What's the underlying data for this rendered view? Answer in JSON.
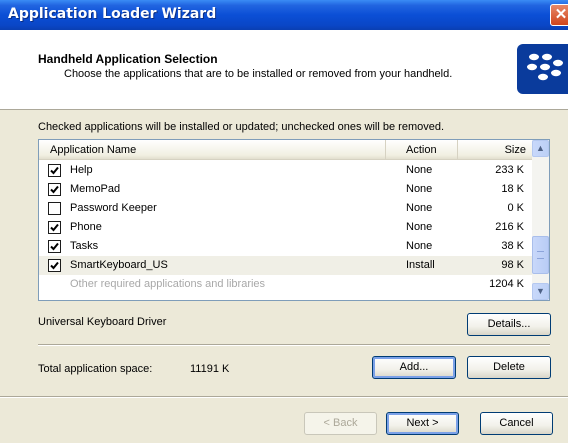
{
  "window": {
    "title": "Application Loader Wizard",
    "close_glyph": "✕"
  },
  "header": {
    "title": "Handheld Application Selection",
    "subtitle": "Choose the applications that are to be installed or removed from your handheld.",
    "logo": "blackberry-logo"
  },
  "info_text": "Checked applications will be installed or updated; unchecked ones will be removed.",
  "list": {
    "columns": [
      "Application Name",
      "Action",
      "Size"
    ],
    "rows": [
      {
        "name": "Help",
        "checked": true,
        "action": "None",
        "size": "233 K"
      },
      {
        "name": "MemoPad",
        "checked": true,
        "action": "None",
        "size": "18 K"
      },
      {
        "name": "Password Keeper",
        "checked": false,
        "action": "None",
        "size": "0 K"
      },
      {
        "name": "Phone",
        "checked": true,
        "action": "None",
        "size": "216 K"
      },
      {
        "name": "Tasks",
        "checked": true,
        "action": "None",
        "size": "38 K"
      },
      {
        "name": "SmartKeyboard_US",
        "checked": true,
        "action": "Install",
        "size": "98 K",
        "selected": true
      },
      {
        "name": "Other required applications and libraries",
        "checked": null,
        "action": "",
        "size": "1204 K",
        "disabled": true
      }
    ]
  },
  "description": "Universal Keyboard Driver",
  "details_button": "Details...",
  "space": {
    "label": "Total application space:",
    "value": "11191 K"
  },
  "buttons": {
    "add": "Add...",
    "delete": "Delete",
    "back": "< Back",
    "next": "Next >",
    "cancel": "Cancel"
  },
  "colors": {
    "titlebar": "#0B4FD6",
    "dialog_bg": "#ECE9D8",
    "logo_bg": "#0A3B9C"
  }
}
